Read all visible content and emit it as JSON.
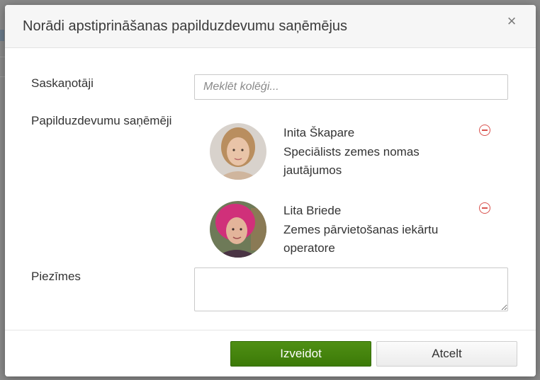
{
  "modal": {
    "title": "Norādi apstiprināšanas papilduzdevumu saņēmējus",
    "close_glyph": "×"
  },
  "form": {
    "approvers_label": "Saskaņotāji",
    "search_placeholder": "Meklēt kolēģi...",
    "recipients_label": "Papilduzdevumu saņēmēji",
    "notes_label": "Piezīmes",
    "notes_value": ""
  },
  "recipients": [
    {
      "name": "Inita Škapare",
      "role": "Speciālists zemes nomas jautājumos",
      "avatar": "avatar-photo-woman-light-hair"
    },
    {
      "name": "Lita Briede",
      "role": "Zemes pārvietošanas iekārtu operatore",
      "avatar": "avatar-photo-woman-pink-hair"
    }
  ],
  "footer": {
    "create_label": "Izveidot",
    "cancel_label": "Atcelt"
  },
  "colors": {
    "primary": "#3c7a08",
    "remove": "#d9534f"
  }
}
